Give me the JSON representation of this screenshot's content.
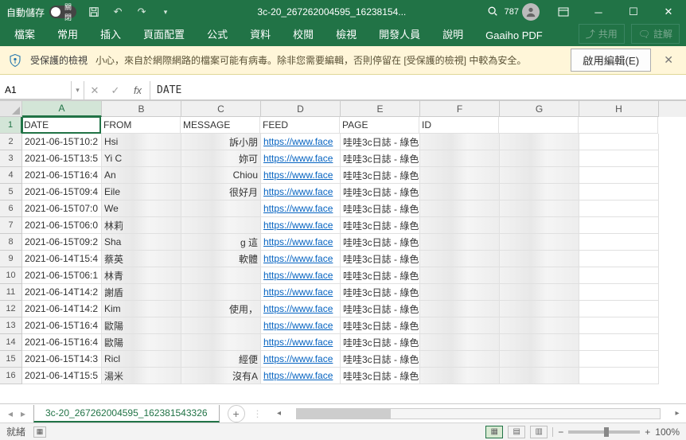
{
  "titlebar": {
    "autosave_label": "自動儲存",
    "autosave_state": "關閉",
    "filename": "3c-20_267262004595_16238154...",
    "search_badge": "787"
  },
  "ribbon": {
    "tabs": [
      "檔案",
      "常用",
      "插入",
      "頁面配置",
      "公式",
      "資料",
      "校閱",
      "檢視",
      "開發人員",
      "說明",
      "Gaaiho PDF"
    ],
    "share": "共用",
    "comment": "註解"
  },
  "protected": {
    "title": "受保護的檢視",
    "message": "小心，來自於網際網路的檔案可能有病毒。除非您需要編輯，否則停留在 [受保護的檢視] 中較為安全。",
    "enable": "啟用編輯(E)"
  },
  "namebox": "A1",
  "formula": "DATE",
  "columns": [
    "A",
    "B",
    "C",
    "D",
    "E",
    "F",
    "G",
    "H"
  ],
  "headers": {
    "A": "DATE",
    "B": "FROM",
    "C": "MESSAGE",
    "D": "FEED",
    "E": "PAGE",
    "F": "ID",
    "G": "",
    "H": ""
  },
  "rows": [
    {
      "n": 2,
      "A": "2021-06-15T10:2",
      "B": "Hsi",
      "C": "訴小朋",
      "D": "https://www.face",
      "E": "哇哇3c日誌 - 綠色"
    },
    {
      "n": 3,
      "A": "2021-06-15T13:5",
      "B": "Yi C",
      "C": "妳可",
      "D": "https://www.face",
      "E": "哇哇3c日誌 - 綠色"
    },
    {
      "n": 4,
      "A": "2021-06-15T16:4",
      "B": "An",
      "C": "Chiou",
      "D": "https://www.face",
      "E": "哇哇3c日誌 - 綠色"
    },
    {
      "n": 5,
      "A": "2021-06-15T09:4",
      "B": "Eile",
      "C": "很好月",
      "D": "https://www.face",
      "E": "哇哇3c日誌 - 綠色"
    },
    {
      "n": 6,
      "A": "2021-06-15T07:0",
      "B": "We",
      "C": "",
      "D": "https://www.face",
      "E": "哇哇3c日誌 - 綠色"
    },
    {
      "n": 7,
      "A": "2021-06-15T06:0",
      "B": "林莉",
      "C": "",
      "D": "https://www.face",
      "E": "哇哇3c日誌 - 綠色"
    },
    {
      "n": 8,
      "A": "2021-06-15T09:2",
      "B": "Sha",
      "C": "g 這",
      "D": "https://www.face",
      "E": "哇哇3c日誌 - 綠色"
    },
    {
      "n": 9,
      "A": "2021-06-14T15:4",
      "B": "蔡英",
      "C": "軟體",
      "D": "https://www.face",
      "E": "哇哇3c日誌 - 綠色"
    },
    {
      "n": 10,
      "A": "2021-06-15T06:1",
      "B": "林青",
      "C": "",
      "D": "https://www.face",
      "E": "哇哇3c日誌 - 綠色"
    },
    {
      "n": 11,
      "A": "2021-06-14T14:2",
      "B": "謝盾",
      "C": "",
      "D": "https://www.face",
      "E": "哇哇3c日誌 - 綠色"
    },
    {
      "n": 12,
      "A": "2021-06-14T14:2",
      "B": "Kim",
      "C": "使用，",
      "D": "https://www.face",
      "E": "哇哇3c日誌 - 綠色"
    },
    {
      "n": 13,
      "A": "2021-06-15T16:4",
      "B": "歐陽",
      "C": "",
      "D": "https://www.face",
      "E": "哇哇3c日誌 - 綠色"
    },
    {
      "n": 14,
      "A": "2021-06-15T16:4",
      "B": "歐陽",
      "C": "",
      "D": "https://www.face",
      "E": "哇哇3c日誌 - 綠色"
    },
    {
      "n": 15,
      "A": "2021-06-15T14:3",
      "B": "Ricl",
      "C": "經便",
      "D": "https://www.face",
      "E": "哇哇3c日誌 - 綠色"
    },
    {
      "n": 16,
      "A": "2021-06-14T15:5",
      "B": "湯米",
      "C": "沒有A",
      "D": "https://www.face",
      "E": "哇哇3c日誌 - 綠色"
    }
  ],
  "sheet": {
    "name": "3c-20_267262004595_162381543326"
  },
  "status": {
    "ready": "就緒",
    "zoom": "100%"
  }
}
